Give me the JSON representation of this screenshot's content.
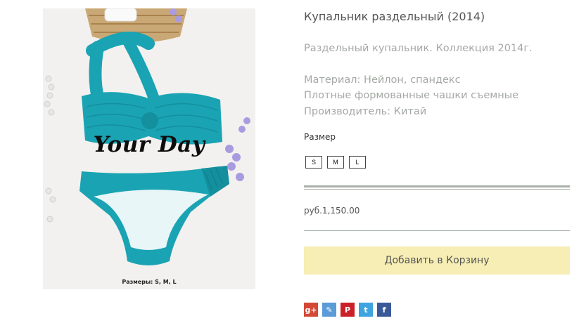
{
  "product": {
    "title": "Купальник раздельный (2014)",
    "image": {
      "brand_text": "Your Day",
      "caption": "Размеры: S, M, L"
    },
    "description": [
      "Раздельный купальник. Коллекция 2014г.",
      "Материал: Нейлон, спандекс",
      "Плотные формованные чашки съемные",
      "Производитель: Китай"
    ],
    "size_label": "Размер",
    "sizes": [
      "S",
      "M",
      "L"
    ],
    "price": "руб.1,150.00",
    "add_to_cart_label": "Добавить в Корзину"
  },
  "social": [
    {
      "name": "google-plus-icon",
      "glyph": "g+",
      "color": "#d34836"
    },
    {
      "name": "livejournal-icon",
      "glyph": "✎",
      "color": "#5a9bd8"
    },
    {
      "name": "pinterest-icon",
      "glyph": "P",
      "color": "#cb2027"
    },
    {
      "name": "twitter-icon",
      "glyph": "t",
      "color": "#3fa4e0"
    },
    {
      "name": "facebook-icon",
      "glyph": "f",
      "color": "#3b5998"
    }
  ],
  "colors": {
    "swimsuit": "#1aa3b3",
    "cart_button": "#f6eeb4",
    "separator": "#a9b0a9"
  }
}
